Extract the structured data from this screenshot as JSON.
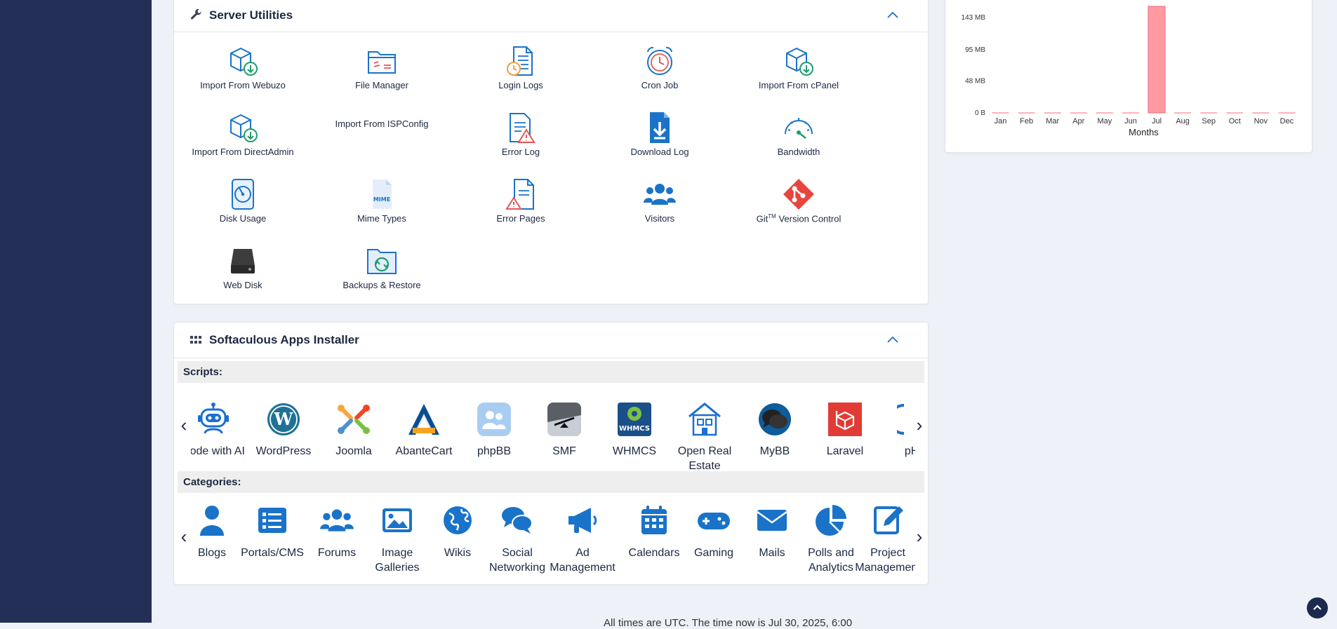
{
  "server_utilities": {
    "title": "Server Utilities",
    "items": [
      {
        "label": "Import From Webuzo",
        "icon": "box-download-icon"
      },
      {
        "label": "File Manager",
        "icon": "folder-icon"
      },
      {
        "label": "Login Logs",
        "icon": "log-clock-icon"
      },
      {
        "label": "Cron Job",
        "icon": "alarm-clock-icon"
      },
      {
        "label": "Import From cPanel",
        "icon": "box-download-icon"
      },
      {
        "label": "Import From DirectAdmin",
        "icon": "box-download-icon"
      },
      {
        "label": "Import From ISPConfig",
        "icon": ""
      },
      {
        "label": "Error Log",
        "icon": "document-warning-icon"
      },
      {
        "label": "Download Log",
        "icon": "download-file-icon"
      },
      {
        "label": "Bandwidth",
        "icon": "gauge-icon"
      },
      {
        "label": "Disk Usage",
        "icon": "disk-usage-icon"
      },
      {
        "label": "Mime Types",
        "icon": "mime-file-icon"
      },
      {
        "label": "Error Pages",
        "icon": "page-warning-icon"
      },
      {
        "label": "Visitors",
        "icon": "users-icon"
      },
      {
        "label": "Git",
        "label_sup": "TM",
        "label_rest": " Version Control",
        "icon": "git-icon"
      },
      {
        "label": "Web Disk",
        "icon": "hard-drive-icon"
      },
      {
        "label": "Backups & Restore",
        "icon": "backup-folder-icon"
      }
    ]
  },
  "softaculous": {
    "title": "Softaculous Apps Installer",
    "scripts_heading": "Scripts:",
    "categories_heading": "Categories:",
    "scripts": [
      {
        "label": "Code with AI",
        "icon": "robot-icon"
      },
      {
        "label": "WordPress",
        "icon": "wordpress-icon"
      },
      {
        "label": "Joomla",
        "icon": "joomla-icon"
      },
      {
        "label": "AbanteCart",
        "icon": "abantecart-icon"
      },
      {
        "label": "phpBB",
        "icon": "phpbb-icon"
      },
      {
        "label": "SMF",
        "icon": "smf-icon"
      },
      {
        "label": "WHMCS",
        "icon": "whmcs-icon"
      },
      {
        "label": "Open Real Estate",
        "icon": "house-icon"
      },
      {
        "label": "MyBB",
        "icon": "mybb-icon"
      },
      {
        "label": "Laravel",
        "icon": "laravel-icon"
      },
      {
        "label": "pHT",
        "icon": "partial-icon"
      }
    ],
    "categories": [
      {
        "label": "Blogs",
        "icon": "user-icon"
      },
      {
        "label": "Portals/CMS",
        "icon": "list-icon"
      },
      {
        "label": "Forums",
        "icon": "users-icon"
      },
      {
        "label": "Image Galleries",
        "icon": "image-icon"
      },
      {
        "label": "Wikis",
        "icon": "globe-icon"
      },
      {
        "label": "Social Networking",
        "icon": "comments-icon"
      },
      {
        "label": "Ad Management",
        "icon": "megaphone-icon"
      },
      {
        "label": "Calendars",
        "icon": "calendar-icon"
      },
      {
        "label": "Gaming",
        "icon": "gamepad-icon"
      },
      {
        "label": "Mails",
        "icon": "envelope-icon"
      },
      {
        "label": "Polls and Analytics",
        "icon": "pie-chart-icon"
      },
      {
        "label": "Project Management",
        "icon": "edit-icon"
      }
    ]
  },
  "chart_data": {
    "type": "bar",
    "categories": [
      "Jan",
      "Feb",
      "Mar",
      "Apr",
      "May",
      "Jun",
      "Jul",
      "Aug",
      "Sep",
      "Oct",
      "Nov",
      "Dec"
    ],
    "values": [
      0,
      0,
      0,
      0,
      0,
      0,
      160,
      0,
      0,
      0,
      0,
      0
    ],
    "ytick_labels": [
      "0 B",
      "48 MB",
      "95 MB",
      "143 MB"
    ],
    "ylim": [
      0,
      160
    ],
    "xlabel": "Months",
    "ylabel": "",
    "title": "",
    "grid": false,
    "bar_color": "#ff9aa2"
  },
  "footer": {
    "text": "All times are UTC. The time now is Jul 30, 2025, 6:00"
  },
  "colors": {
    "sidebar": "#242f58",
    "accent": "#1a73c8",
    "scroll_top_button": "#1c2a4e"
  }
}
